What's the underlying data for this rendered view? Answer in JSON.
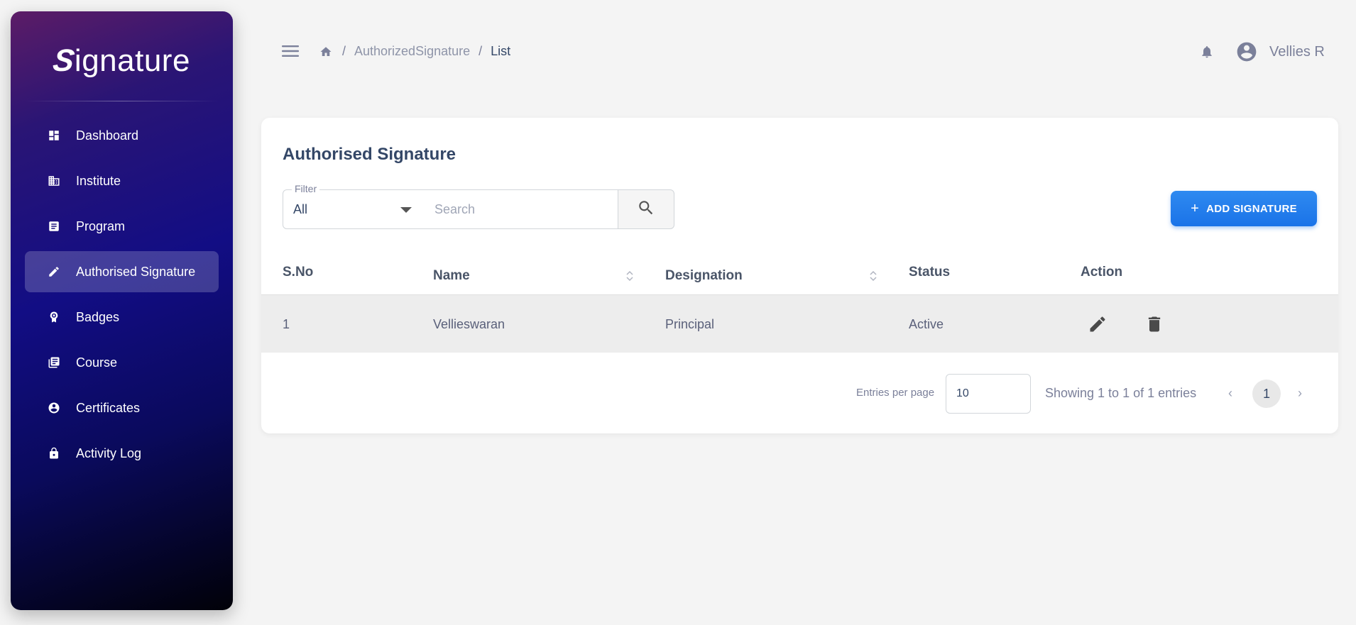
{
  "brand": {
    "logo_text": "ignature",
    "logo_mark": "S"
  },
  "sidebar": {
    "items": [
      {
        "label": "Dashboard",
        "icon": "dashboard-icon",
        "active": false
      },
      {
        "label": "Institute",
        "icon": "building-icon",
        "active": false
      },
      {
        "label": "Program",
        "icon": "document-icon",
        "active": false
      },
      {
        "label": "Authorised Signature",
        "icon": "pencil-icon",
        "active": true
      },
      {
        "label": "Badges",
        "icon": "badge-icon",
        "active": false
      },
      {
        "label": "Course",
        "icon": "library-icon",
        "active": false
      },
      {
        "label": "Certificates",
        "icon": "user-circle-icon",
        "active": false
      },
      {
        "label": "Activity Log",
        "icon": "lock-icon",
        "active": false
      }
    ]
  },
  "header": {
    "breadcrumb": {
      "sep": "/",
      "link": "AuthorizedSignature",
      "current": "List"
    },
    "user_name": "Vellies R"
  },
  "card": {
    "title": "Authorised Signature",
    "filter": {
      "label": "Filter",
      "value": "All"
    },
    "search": {
      "placeholder": "Search"
    },
    "add_button": {
      "icon": "+",
      "label": "ADD SIGNATURE"
    }
  },
  "table": {
    "columns": [
      "S.No",
      "Name",
      "Designation",
      "Status",
      "Action"
    ],
    "rows": [
      {
        "sno": "1",
        "name": "Vellieswaran",
        "designation": "Principal",
        "status": "Active"
      }
    ]
  },
  "pagination": {
    "entries_label": "Entries per page",
    "entries_value": "10",
    "showing": "Showing 1 to 1 of 1 entries",
    "prev": "‹",
    "next": "›",
    "current_page": "1"
  },
  "colors": {
    "accent": "#1a73e8",
    "sidebar_top": "#5c1c66",
    "sidebar_bottom": "#010108",
    "background": "#f4f4f4"
  }
}
